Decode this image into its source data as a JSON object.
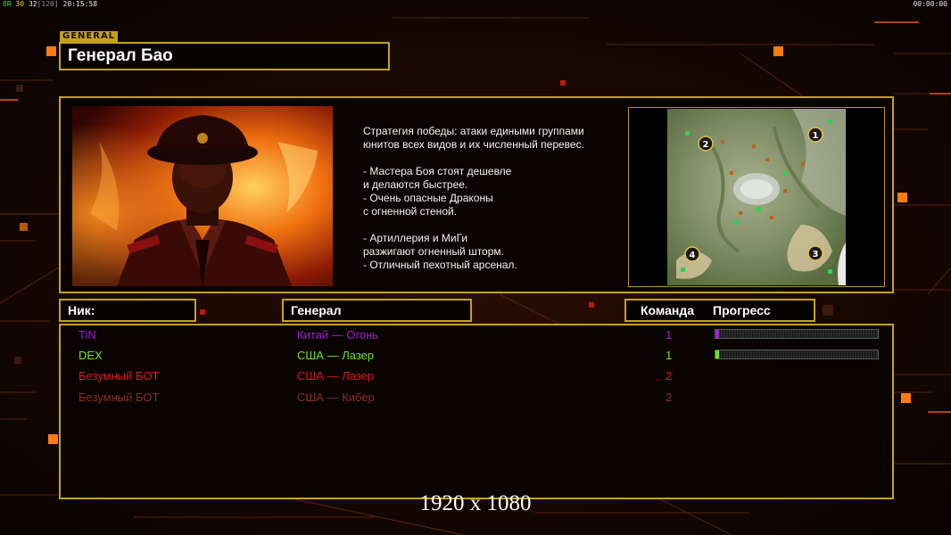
{
  "hud": {
    "fps_prefix": "0R",
    "fps_value": "30",
    "fps_limit": "32",
    "fps_cap": "[120]",
    "clock": "20:15:58",
    "timer": "00:00:00"
  },
  "colors": {
    "gold": "#c8a020",
    "china_player": "#a020d0",
    "usa_laser_1": "#70e030",
    "usa_laser_2": "#e01818",
    "usa_cyber": "#8a3020"
  },
  "general": {
    "tag": "GENERAL",
    "name": "Генерал Бао",
    "strategy": "Стратегия победы: атаки едиными группами\nюнитов всех видов и их численный перевес.\n\n- Мастера Боя стоят дешевле\nи делаются быстрее.\n- Очень опасные Драконы\nс огненной стеной.\n\n- Артиллерия и МиГи\nразжигают огненный шторм.\n- Отличный пехотный арсенал."
  },
  "map": {
    "start_positions": [
      "1",
      "2",
      "3",
      "4"
    ]
  },
  "columns": {
    "nick": "Ник:",
    "general": "Генерал",
    "team": "Команда",
    "progress": "Прогресс"
  },
  "players": [
    {
      "nick": "TiN",
      "general": "Китай — Огонь",
      "team": "1",
      "color": "#a020d0",
      "progress": 0.02
    },
    {
      "nick": "DEX",
      "general": "США — Лазер",
      "team": "1",
      "color": "#70e030",
      "progress": 0.01
    },
    {
      "nick": "Безумный БОТ",
      "general": "США — Лазер",
      "team": "2",
      "color": "#e01818",
      "progress": null
    },
    {
      "nick": "Безумный БОТ",
      "general": "США — Кибер",
      "team": "2",
      "color": "#8a3020",
      "progress": null
    }
  ],
  "resolution_label": "1920 x 1080"
}
